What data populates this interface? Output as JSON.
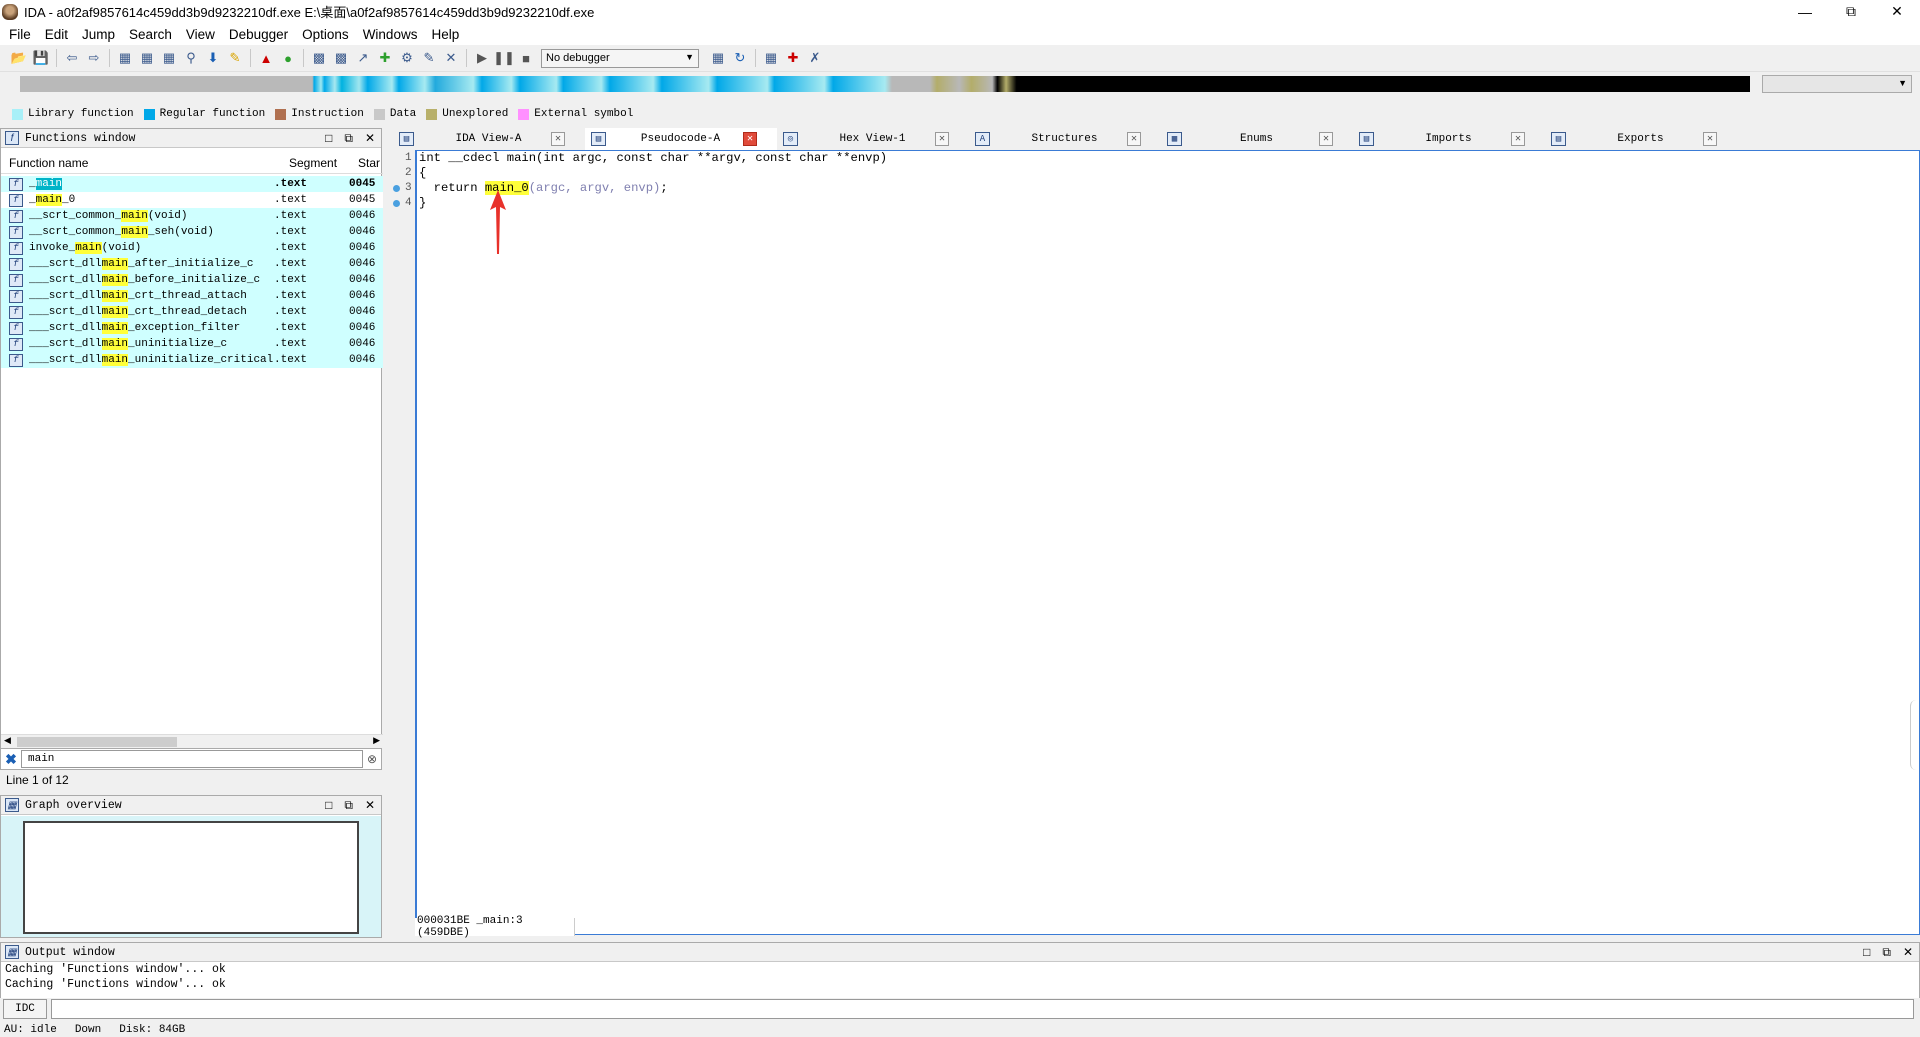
{
  "window": {
    "title": "IDA - a0f2af9857614c459dd3b9d9232210df.exe E:\\桌面\\a0f2af9857614c459dd3b9d9232210df.exe"
  },
  "menu": [
    "File",
    "Edit",
    "Jump",
    "Search",
    "View",
    "Debugger",
    "Options",
    "Windows",
    "Help"
  ],
  "toolbar": {
    "debugger_select": "No debugger"
  },
  "legend": [
    {
      "label": "Library function",
      "color": "#a8f0f8"
    },
    {
      "label": "Regular function",
      "color": "#00a8e8"
    },
    {
      "label": "Instruction",
      "color": "#b07050"
    },
    {
      "label": "Data",
      "color": "#c8c8c8"
    },
    {
      "label": "Unexplored",
      "color": "#b8b06a"
    },
    {
      "label": "External symbol",
      "color": "#ff90ff"
    }
  ],
  "functions_window": {
    "title": "Functions window",
    "columns": [
      "Function name",
      "Segment",
      "Star"
    ],
    "rows": [
      {
        "pre": "_",
        "hl": "main",
        "post": "",
        "seg": ".text",
        "addr": "0045",
        "selected": true
      },
      {
        "pre": "_",
        "hl": "main",
        "post": "_0",
        "seg": ".text",
        "addr": "0045"
      },
      {
        "pre": "__scrt_common_",
        "hl": "main",
        "post": "(void)",
        "seg": ".text",
        "addr": "0046"
      },
      {
        "pre": "__scrt_common_",
        "hl": "main",
        "post": "_seh(void)",
        "seg": ".text",
        "addr": "0046"
      },
      {
        "pre": "invoke_",
        "hl": "main",
        "post": "(void)",
        "seg": ".text",
        "addr": "0046"
      },
      {
        "pre": "___scrt_dll",
        "hl": "main",
        "post": "_after_initialize_c",
        "seg": ".text",
        "addr": "0046"
      },
      {
        "pre": "___scrt_dll",
        "hl": "main",
        "post": "_before_initialize_c",
        "seg": ".text",
        "addr": "0046"
      },
      {
        "pre": "___scrt_dll",
        "hl": "main",
        "post": "_crt_thread_attach",
        "seg": ".text",
        "addr": "0046"
      },
      {
        "pre": "___scrt_dll",
        "hl": "main",
        "post": "_crt_thread_detach",
        "seg": ".text",
        "addr": "0046"
      },
      {
        "pre": "___scrt_dll",
        "hl": "main",
        "post": "_exception_filter",
        "seg": ".text",
        "addr": "0046"
      },
      {
        "pre": "___scrt_dll",
        "hl": "main",
        "post": "_uninitialize_c",
        "seg": ".text",
        "addr": "0046"
      },
      {
        "pre": "___scrt_dll",
        "hl": "main",
        "post": "_uninitialize_critical",
        "seg": ".text",
        "addr": "0046"
      }
    ],
    "search_value": "main",
    "line_info": "Line 1 of 12"
  },
  "graph_overview": {
    "title": "Graph overview"
  },
  "tabs": [
    {
      "label": "IDA View-A",
      "icon": "ida-view-icon",
      "active": false
    },
    {
      "label": "Pseudocode-A",
      "icon": "pseudocode-icon",
      "active": true
    },
    {
      "label": "Hex View-1",
      "icon": "hex-view-icon",
      "active": false
    },
    {
      "label": "Structures",
      "icon": "structures-icon",
      "active": false
    },
    {
      "label": "Enums",
      "icon": "enums-icon",
      "active": false
    },
    {
      "label": "Imports",
      "icon": "imports-icon",
      "active": false
    },
    {
      "label": "Exports",
      "icon": "exports-icon",
      "active": false
    }
  ],
  "code": {
    "line1": "int __cdecl main(int argc, const char **argv, const char **envp)",
    "line2": "{",
    "line3_pre": "  return ",
    "line3_call": "main_0",
    "line3_args": "(argc, argv, envp)",
    "line3_post": ";",
    "line4": "}",
    "status": "000031BE _main:3 (459DBE)"
  },
  "output": {
    "title": "Output window",
    "lines": [
      "Caching 'Functions window'... ok",
      "Caching 'Functions window'... ok"
    ],
    "idc_label": "IDC"
  },
  "statusbar": {
    "au": "AU:  idle",
    "dir": "Down",
    "disk": "Disk: 84GB"
  }
}
